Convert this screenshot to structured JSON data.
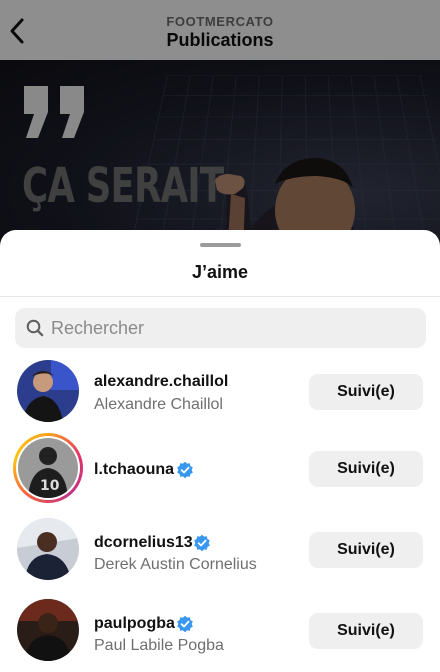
{
  "header": {
    "account_name": "FOOTMERCATO",
    "title": "Publications"
  },
  "post": {
    "headline": "ÇA SERAIT"
  },
  "sheet": {
    "title": "J’aime"
  },
  "search": {
    "placeholder": "Rechercher",
    "value": ""
  },
  "users": [
    {
      "username": "alexandre.chaillol",
      "full_name": "Alexandre Chaillol",
      "verified": false,
      "story_ring": false,
      "button_label": "Suivi(e)"
    },
    {
      "username": "l.tchaouna",
      "full_name": "",
      "verified": true,
      "story_ring": true,
      "button_label": "Suivi(e)"
    },
    {
      "username": "dcornelius13",
      "full_name": "Derek Austin Cornelius",
      "verified": true,
      "story_ring": false,
      "button_label": "Suivi(e)"
    },
    {
      "username": "paulpogba",
      "full_name": "Paul Labile Pogba",
      "verified": true,
      "story_ring": false,
      "button_label": "Suivi(e)"
    }
  ],
  "colors": {
    "verified_badge": "#3897f0",
    "follow_button_bg": "#efefef"
  },
  "icons": {
    "back": "chevron-left-icon",
    "search": "search-icon",
    "verified": "verified-badge-icon"
  }
}
